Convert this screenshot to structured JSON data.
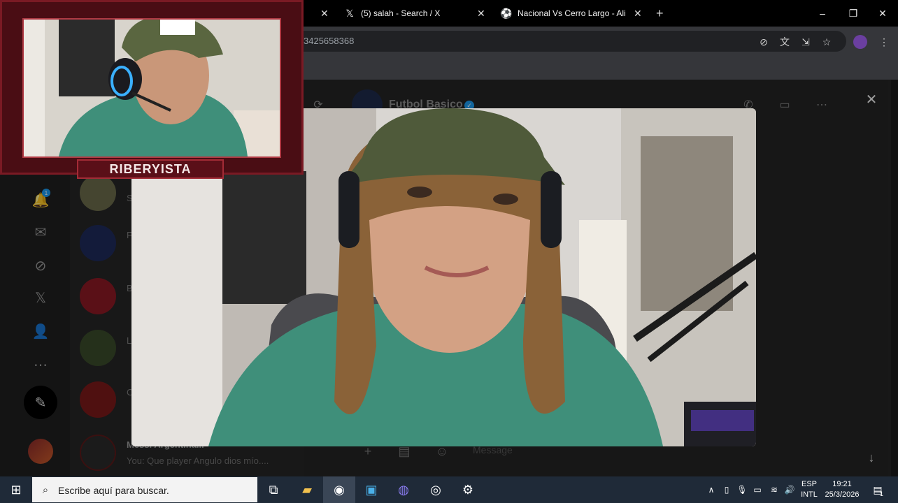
{
  "browser": {
    "tabs": [
      {
        "label": "(5) salah - Search / X",
        "icon": "x-logo-icon"
      },
      {
        "label": "Nacional Vs Cerro Largo - Aline",
        "icon": "soccer-ball-icon"
      }
    ],
    "new_tab_icon": "+",
    "window_controls": [
      "–",
      "❐",
      "✕"
    ],
    "url": "3425658368"
  },
  "page": {
    "chat_header": {
      "name": "Futbol Basico",
      "verified": true
    },
    "conversations": [
      {
        "preview_initial": "S"
      },
      {
        "preview_initial": "F"
      },
      {
        "preview_initial": "B"
      },
      {
        "preview_initial": "L"
      },
      {
        "preview_initial": "C"
      }
    ],
    "last_conversation": {
      "name": "Messi Argentina...",
      "message": "You: Que player Angulo dios mío...."
    },
    "composer_placeholder": "Message",
    "notification_count": "1"
  },
  "overlay": {
    "streamer_name": "RIBERYISTA"
  },
  "taskbar": {
    "search_placeholder": "Escribe aquí para buscar.",
    "language_line1": "ESP",
    "language_line2": "INTL",
    "time": "19:21",
    "date": "25/3/2026",
    "notifications_count": "1"
  },
  "colors": {
    "accent_blue": "#1d9bf0",
    "stream_frame": "#4a0d14",
    "taskbar": "#1f2a38"
  }
}
